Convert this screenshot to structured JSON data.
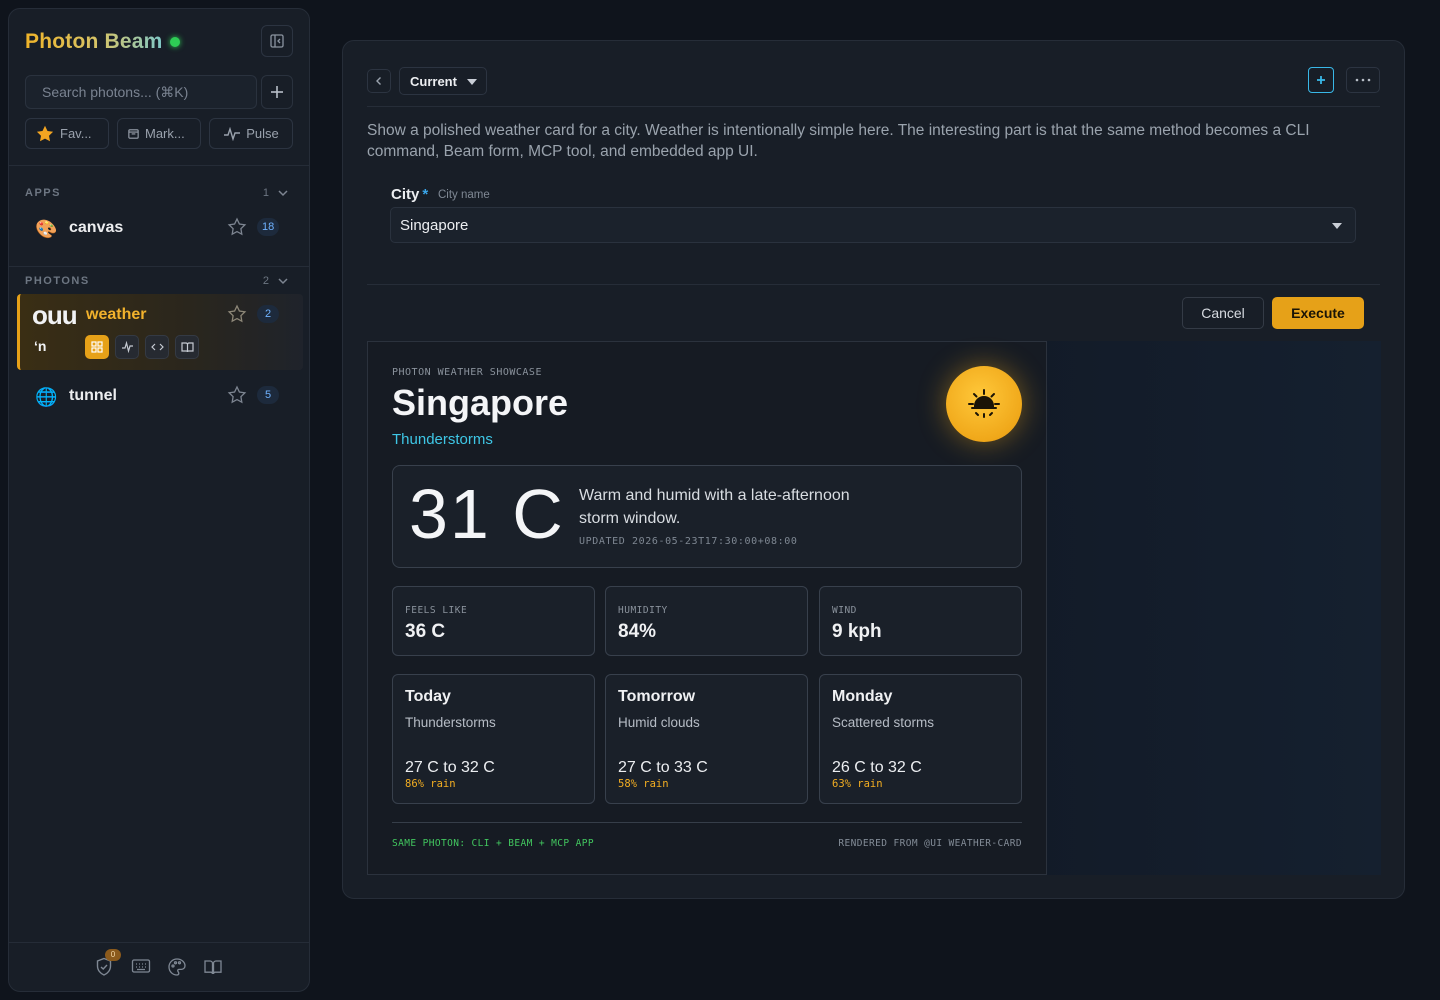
{
  "sidebar": {
    "brand": "Photon Beam",
    "search": {
      "placeholder": "Search photons... (⌘K)"
    },
    "quick": [
      {
        "label": "Fav..."
      },
      {
        "label": "Mark..."
      },
      {
        "label": "Pulse"
      }
    ],
    "apps": {
      "label": "APPS",
      "count": "1"
    },
    "photons": {
      "label": "PHOTONS",
      "count": "2"
    },
    "items": [
      {
        "label": "canvas",
        "count": "18",
        "icon": "palette-icon"
      },
      {
        "label": "weather",
        "count": "2",
        "icon": "weather-photon-icon",
        "icon_text_top": "ouu",
        "icon_text_bottom": "ʻn"
      },
      {
        "label": "tunnel",
        "count": "5",
        "icon": "globe-icon"
      }
    ],
    "footer": {
      "badge": "0"
    }
  },
  "toolbar": {
    "version": "Current"
  },
  "description": "Show a polished weather card for a city. Weather is intentionally simple here. The interesting part is that the same method becomes a CLI command, Beam form, MCP tool, and embedded app UI.",
  "form": {
    "field_label": "City",
    "required_mark": "*",
    "field_hint": "City name",
    "field_value": "Singapore",
    "cancel_label": "Cancel",
    "execute_label": "Execute"
  },
  "weather_card": {
    "eyebrow": "PHOTON WEATHER SHOWCASE",
    "city": "Singapore",
    "condition": "Thunderstorms",
    "temperature": "31 C",
    "summary": "Warm and humid with a late-afternoon storm window.",
    "updated": "UPDATED 2026-05-23T17:30:00+08:00",
    "stats": [
      {
        "label": "FEELS LIKE",
        "value": "36 C"
      },
      {
        "label": "HUMIDITY",
        "value": "84%"
      },
      {
        "label": "WIND",
        "value": "9 kph"
      }
    ],
    "forecast": [
      {
        "day": "Today",
        "condition": "Thunderstorms",
        "range": "27 C to 32 C",
        "rain": "86% rain"
      },
      {
        "day": "Tomorrow",
        "condition": "Humid clouds",
        "range": "27 C to 33 C",
        "rain": "58% rain"
      },
      {
        "day": "Monday",
        "condition": "Scattered storms",
        "range": "26 C to 32 C",
        "rain": "63% rain"
      }
    ],
    "footer_left": "SAME PHOTON: CLI + BEAM + MCP APP",
    "footer_right": "RENDERED FROM @UI WEATHER-CARD"
  },
  "colors": {
    "accent": "#e6a118",
    "link": "#3ec7e6",
    "status_online": "#2ecc55",
    "rain": "#f2ad22"
  }
}
